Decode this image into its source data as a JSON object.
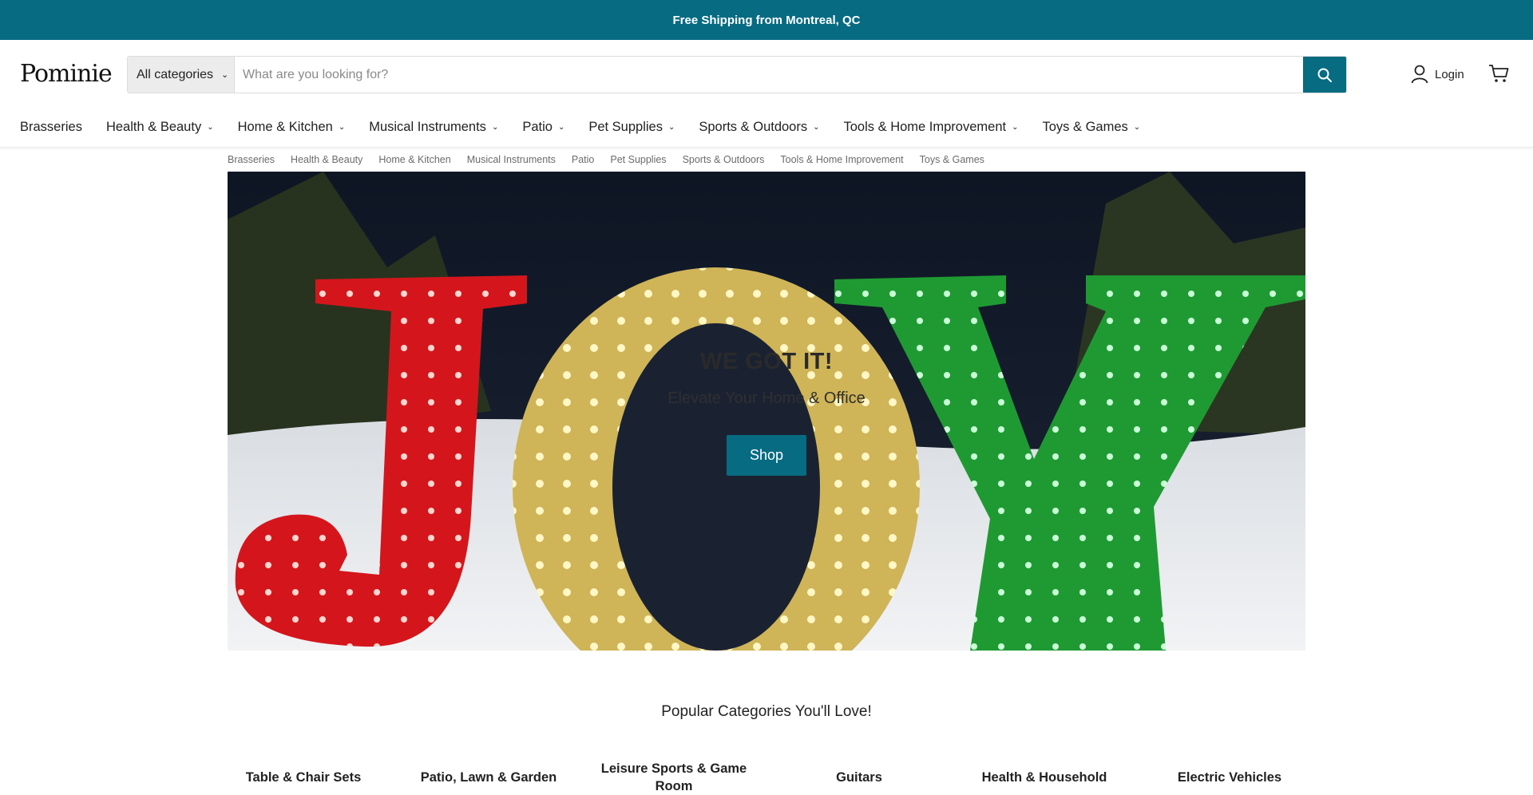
{
  "announcement": "Free Shipping from Montreal, QC",
  "brand": {
    "logo_text": "Pominie",
    "accent_color": "#076b82"
  },
  "search": {
    "category_label": "All categories",
    "placeholder": "What are you looking for?",
    "value": ""
  },
  "account": {
    "login_label": "Login"
  },
  "nav": [
    {
      "label": "Brasseries",
      "has_dropdown": false
    },
    {
      "label": "Health & Beauty",
      "has_dropdown": true
    },
    {
      "label": "Home & Kitchen",
      "has_dropdown": true
    },
    {
      "label": "Musical Instruments",
      "has_dropdown": true
    },
    {
      "label": "Patio",
      "has_dropdown": true
    },
    {
      "label": "Pet Supplies",
      "has_dropdown": true
    },
    {
      "label": "Sports & Outdoors",
      "has_dropdown": true
    },
    {
      "label": "Tools & Home Improvement",
      "has_dropdown": true
    },
    {
      "label": "Toys & Games",
      "has_dropdown": true
    }
  ],
  "subnav": [
    "Brasseries",
    "Health & Beauty",
    "Home & Kitchen",
    "Musical Instruments",
    "Patio",
    "Pet Supplies",
    "Sports & Outdoors",
    "Tools & Home Improvement",
    "Toys & Games"
  ],
  "hero": {
    "heading": "WE GOT IT!",
    "subheading": "Elevate Your Home & Office",
    "button_label": "Shop",
    "image_subject": "JOY"
  },
  "popular": {
    "title": "Popular Categories You'll Love!",
    "categories": [
      "Table & Chair Sets",
      "Patio, Lawn & Garden",
      "Leisure Sports & Game Room",
      "Guitars",
      "Health & Household",
      "Electric Vehicles"
    ]
  }
}
